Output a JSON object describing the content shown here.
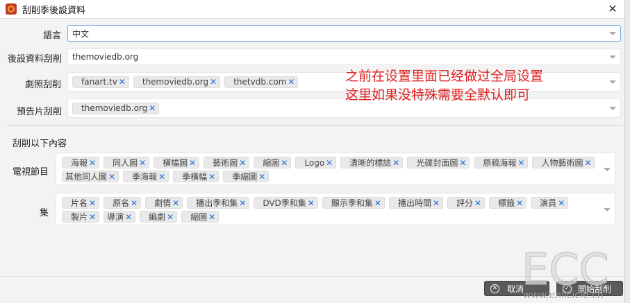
{
  "window": {
    "title": "刮削季後設資料"
  },
  "fields": {
    "language": {
      "label": "語言",
      "value": "中文"
    },
    "metadata_scraper": {
      "label": "後設資料刮削",
      "value": "themoviedb.org"
    },
    "image_scraper": {
      "label": "劇照刮削",
      "tags": [
        "fanart.tv",
        "themoviedb.org",
        "thetvdb.com"
      ]
    },
    "trailer_scraper": {
      "label": "預告片刮削",
      "tags": [
        "themoviedb.org"
      ]
    }
  },
  "scrape_section": {
    "heading": "刮削以下內容",
    "tv_program": {
      "label": "電視節目",
      "tags": [
        "海報",
        "同人圖",
        "橫幅圖",
        "藝術圖",
        "縮圖",
        "Logo",
        "清晰的標誌",
        "光碟封面圖",
        "原稿海報",
        "人物藝術圖",
        "其他同人圖",
        "季海報",
        "季橫幅",
        "季縮圖"
      ]
    },
    "episode": {
      "label": "集",
      "tags": [
        "片名",
        "原名",
        "劇情",
        "播出季和集",
        "DVD季和集",
        "顯示季和集",
        "播出時間",
        "評分",
        "標籤",
        "演員",
        "製片",
        "導演",
        "編劇",
        "縮圖"
      ]
    }
  },
  "annotation": {
    "line1": "之前在设置里面已经做过全局设置",
    "line2": "这里如果没特殊需要全默认即可"
  },
  "footer": {
    "cancel_label": "取消",
    "start_label": "開始刮削"
  },
  "watermark": {
    "text": "ECC",
    "url": "www.enlicicle.cn"
  },
  "colors": {
    "tag_x": "#1e6fd9",
    "annotation": "#e02020",
    "focus_border": "#6ea6e8"
  }
}
